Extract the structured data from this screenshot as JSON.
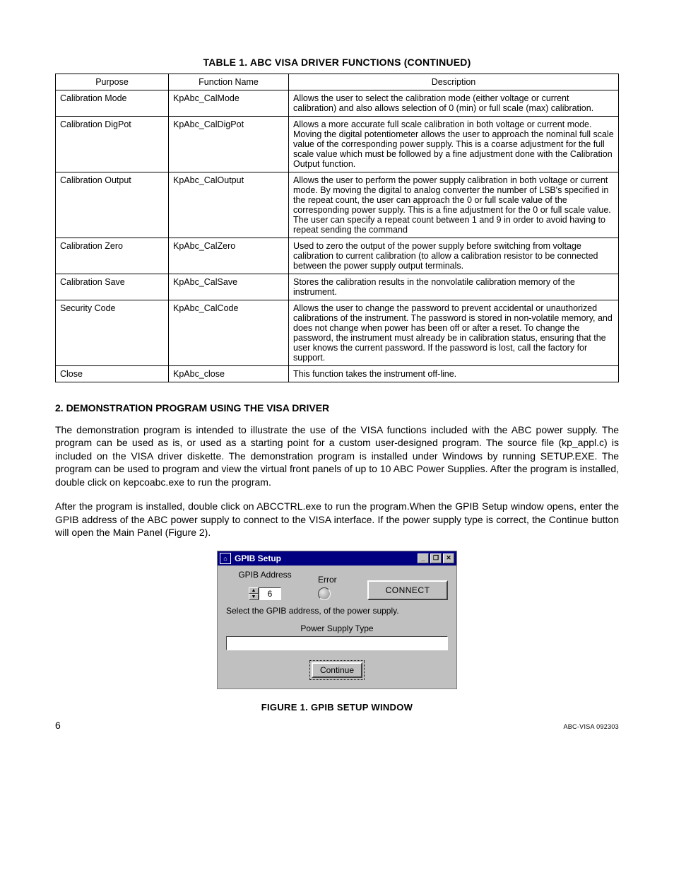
{
  "table": {
    "title": "TABLE 1.  ABC VISA DRIVER FUNCTIONS  (CONTINUED)",
    "headers": {
      "c1": "Purpose",
      "c2": "Function Name",
      "c3": "Description"
    },
    "rows": [
      {
        "purpose": "Calibration Mode",
        "func": "KpAbc_CalMode",
        "desc": "Allows the user to select the calibration mode (either voltage or current calibration) and also allows selection of 0 (min) or full scale (max) calibration."
      },
      {
        "purpose": "Calibration DigPot",
        "func": "KpAbc_CalDigPot",
        "desc": "Allows a more accurate full scale calibration in both voltage or current mode. Moving the digital potentiometer allows the user to approach the nominal full scale value of the corresponding power supply. This is a coarse adjustment for the full scale value which must be followed by a fine adjustment done with the Calibration Output function."
      },
      {
        "purpose": "Calibration Output",
        "func": "KpAbc_CalOutput",
        "desc": "Allows the user to perform the power supply calibration in both voltage or current mode. By moving the digital to analog converter the number of LSB's specified in the repeat count, the user can approach the 0 or full scale value of the corresponding power supply. This is a fine adjustment for the 0 or full scale value. The user can specify a repeat count between 1 and 9 in order to avoid having to repeat sending the command"
      },
      {
        "purpose": "Calibration Zero",
        "func": "KpAbc_CalZero",
        "desc": "Used to zero the output of the power supply before switching from voltage calibration to current calibration (to allow a calibration resistor to be connected between the power supply output terminals."
      },
      {
        "purpose": "Calibration Save",
        "func": "KpAbc_CalSave",
        "desc": "Stores the calibration results in the nonvolatile calibration memory of the instrument."
      },
      {
        "purpose": "Security Code",
        "func": "KpAbc_CalCode",
        "desc": "Allows the user to change the password to prevent accidental or unauthorized calibrations of the instrument. The password is stored in non-volatile memory, and does not change when power has been off or after a reset. To change the password, the instrument must already be in calibration status, ensuring that the user knows the current password. If the password is lost, call the factory for support."
      },
      {
        "purpose": "Close",
        "func": "KpAbc_close",
        "desc": "This function takes the instrument off-line."
      }
    ]
  },
  "section2": {
    "heading": "2.      DEMONSTRATION PROGRAM USING THE VISA DRIVER",
    "para1": "The demonstration program is intended to illustrate the use of the VISA functions included with the ABC power supply. The program can be used as is, or used as a starting point for a custom user-designed program. The source file (kp_appl.c) is included on the VISA driver diskette. The demonstration program is installed under Windows by running SETUP.EXE. The program can be used to program and view the virtual front panels of up to 10 ABC Power Supplies. After the program is installed, double click on kepcoabc.exe to run the program.",
    "para2": "After the program is installed, double click on ABCCTRL.exe to run the program.When the GPIB Setup window opens, enter the GPIB address of the ABC power supply to connect to the VISA interface. If the power supply type is correct,  the Continue button will open the Main Panel (Figure 2)."
  },
  "gpib": {
    "title": "GPIB Setup",
    "addr_label": "GPIB Address",
    "addr_value": "6",
    "error_label": "Error",
    "connect_label": "CONNECT",
    "hint": "Select the GPIB address, of the power supply.",
    "pst_label": "Power Supply Type",
    "pst_value": "",
    "continue_label": "Continue"
  },
  "figure_caption": "FIGURE 1.    GPIB SETUP WINDOW",
  "footer": {
    "page": "6",
    "doc_id": "ABC-VISA 092303"
  }
}
